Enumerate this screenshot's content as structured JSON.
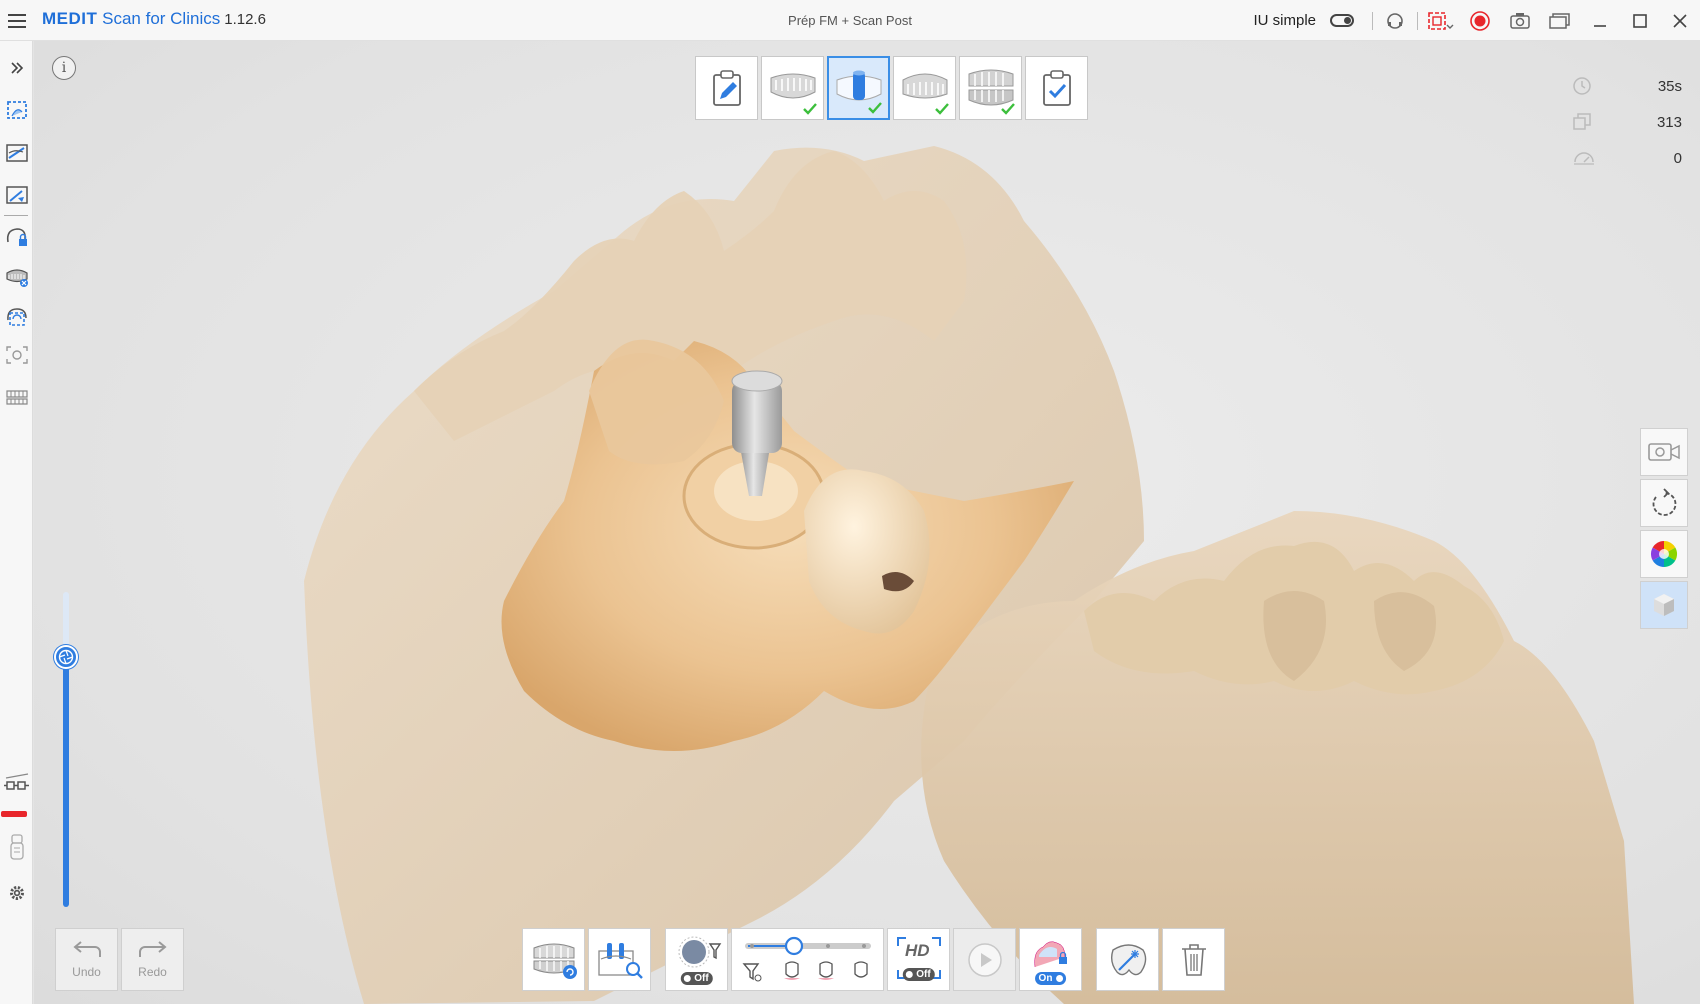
{
  "app": {
    "brand": "MEDIT",
    "name": "Scan for Clinics",
    "version": "1.12.6"
  },
  "document": {
    "title": "Prép FM + Scan Post"
  },
  "titlebar": {
    "mode_label": "IU simple"
  },
  "stats": {
    "time": "35s",
    "frames": "313",
    "count": "0"
  },
  "history": {
    "undo_label": "Undo",
    "redo_label": "Redo"
  },
  "toolbar": {
    "filter_toggle": "Off",
    "hd_label": "HD",
    "hd_toggle": "Off",
    "lock_toggle": "On"
  },
  "stages": [
    {
      "name": "form",
      "checked": false
    },
    {
      "name": "maxilla",
      "checked": true
    },
    {
      "name": "scan-body",
      "checked": true,
      "active": true
    },
    {
      "name": "mandible",
      "checked": true
    },
    {
      "name": "occlusion",
      "checked": true
    },
    {
      "name": "review",
      "checked": false
    }
  ],
  "colors": {
    "accent": "#2f7de0",
    "brand": "#1f6fd8",
    "record": "#e8262b",
    "check": "#3cbf3c"
  }
}
